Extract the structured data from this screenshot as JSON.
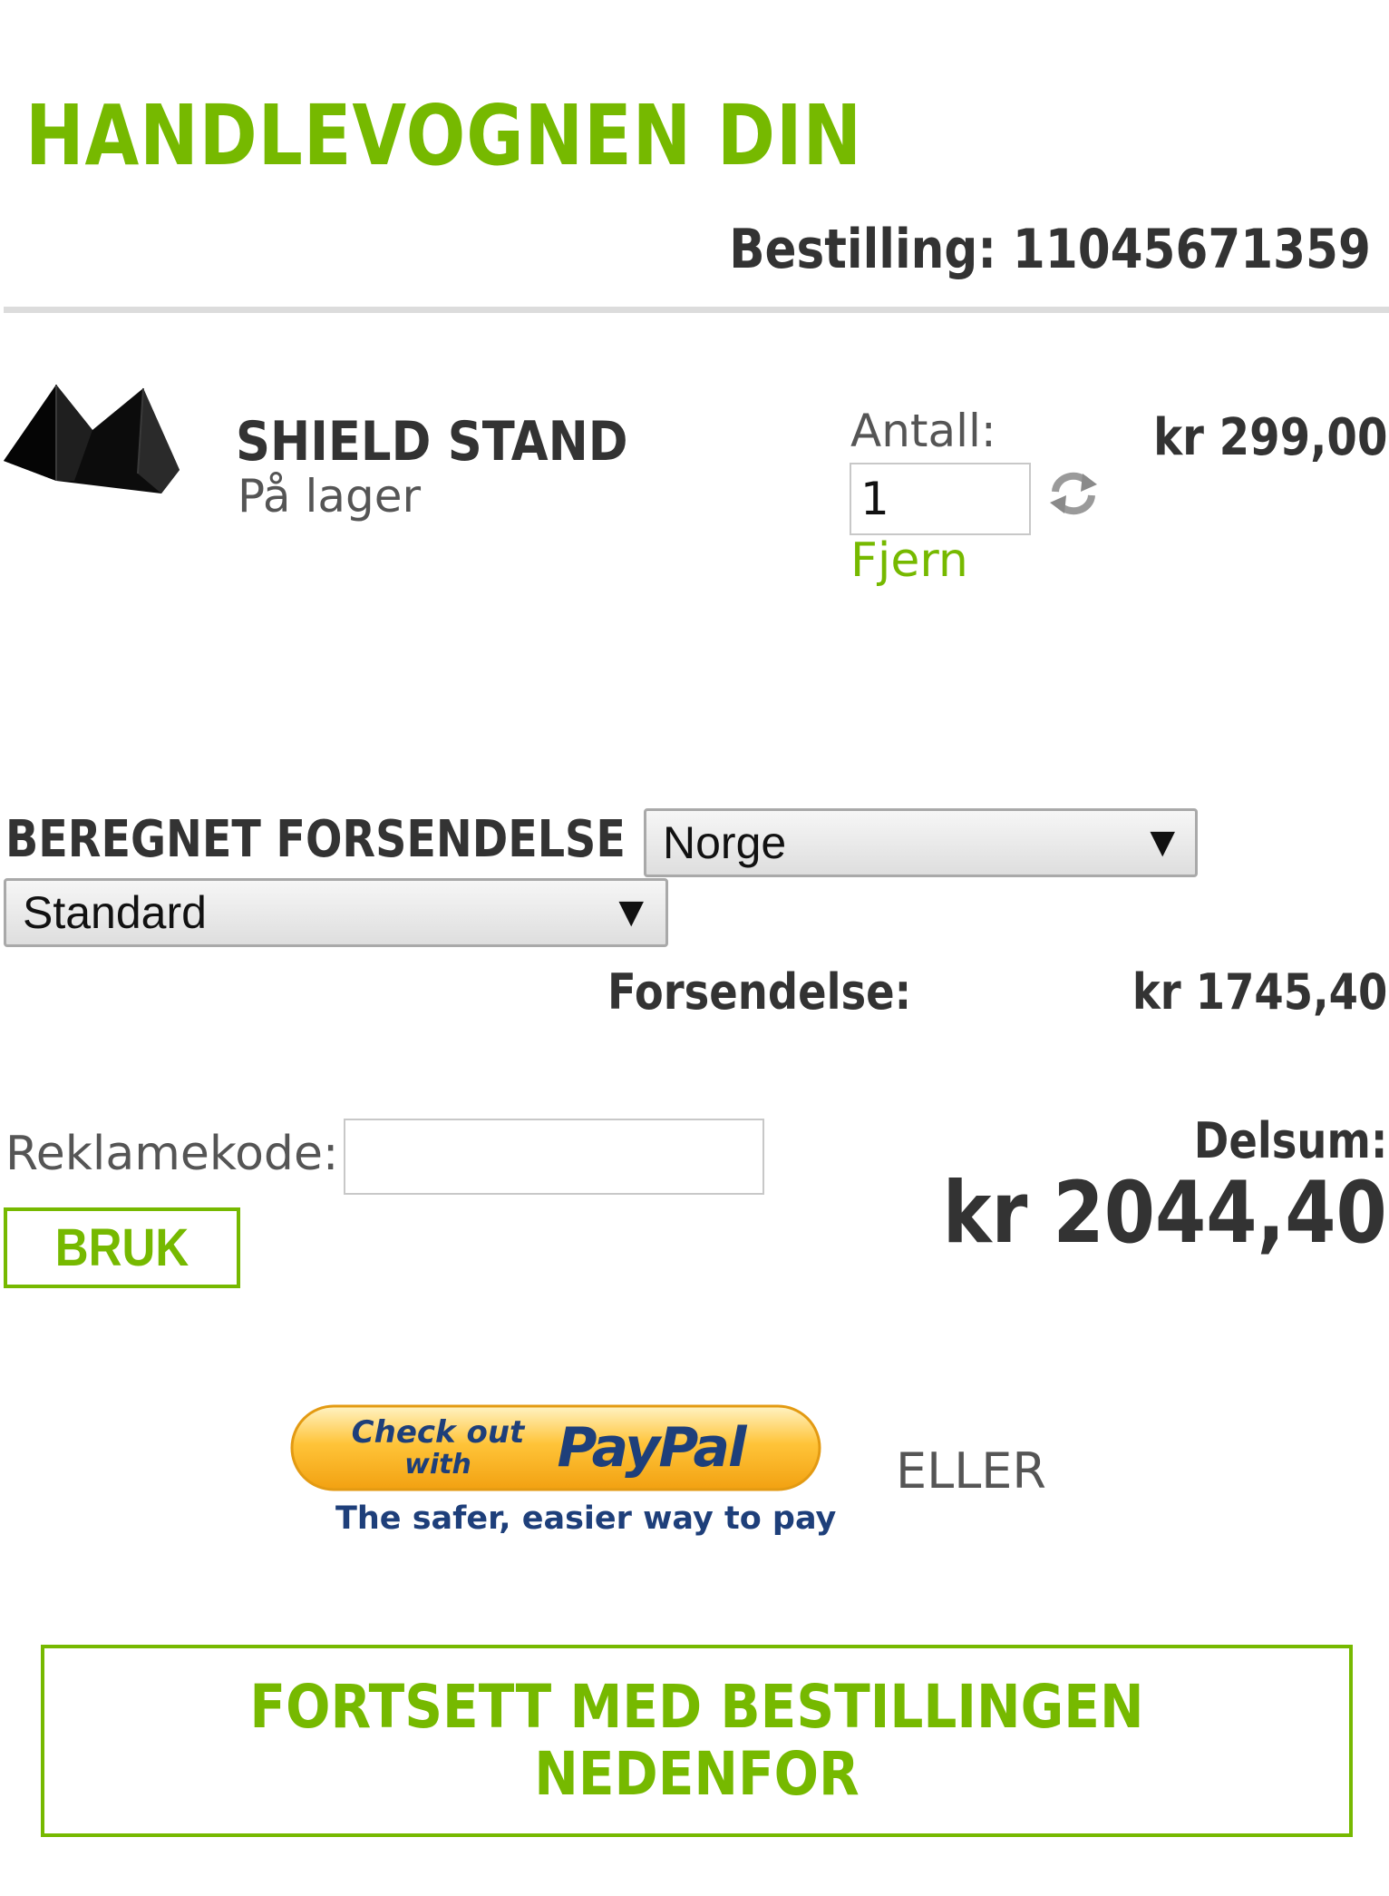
{
  "header": {
    "title": "HANDLEVOGNEN DIN",
    "order_label": "Bestilling: 11045671359"
  },
  "cart_item": {
    "image_icon": "product-image-triangle-stand",
    "name": "SHIELD STAND",
    "stock_status": "På lager",
    "quantity_label": "Antall:",
    "quantity_value": "1",
    "refresh_icon": "refresh-icon",
    "remove_label": "Fjern",
    "price": "kr 299,00"
  },
  "shipping": {
    "label": "BEREGNET FORSENDELSE",
    "country_selected": "Norge",
    "method_selected": "Standard",
    "cost_label": "Forsendelse:",
    "cost_value": "kr 1745,40"
  },
  "promo": {
    "label": "Reklamekode:",
    "value": "",
    "apply_label": "BRUK"
  },
  "summary": {
    "subtotal_label": "Delsum:",
    "subtotal_value": "kr 2044,40"
  },
  "checkout": {
    "paypal_line1": "Check out",
    "paypal_line2": "with",
    "paypal_brand": "PayPal",
    "paypal_tagline": "The safer, easier way to pay",
    "or_label": "ELLER",
    "continue_label": "FORTSETT MED BESTILLINGEN\nNEDENFOR"
  },
  "colors": {
    "accent": "#76b900",
    "text": "#333333",
    "paypal_orange": "#f7a823",
    "paypal_blue": "#1e3f7a"
  }
}
